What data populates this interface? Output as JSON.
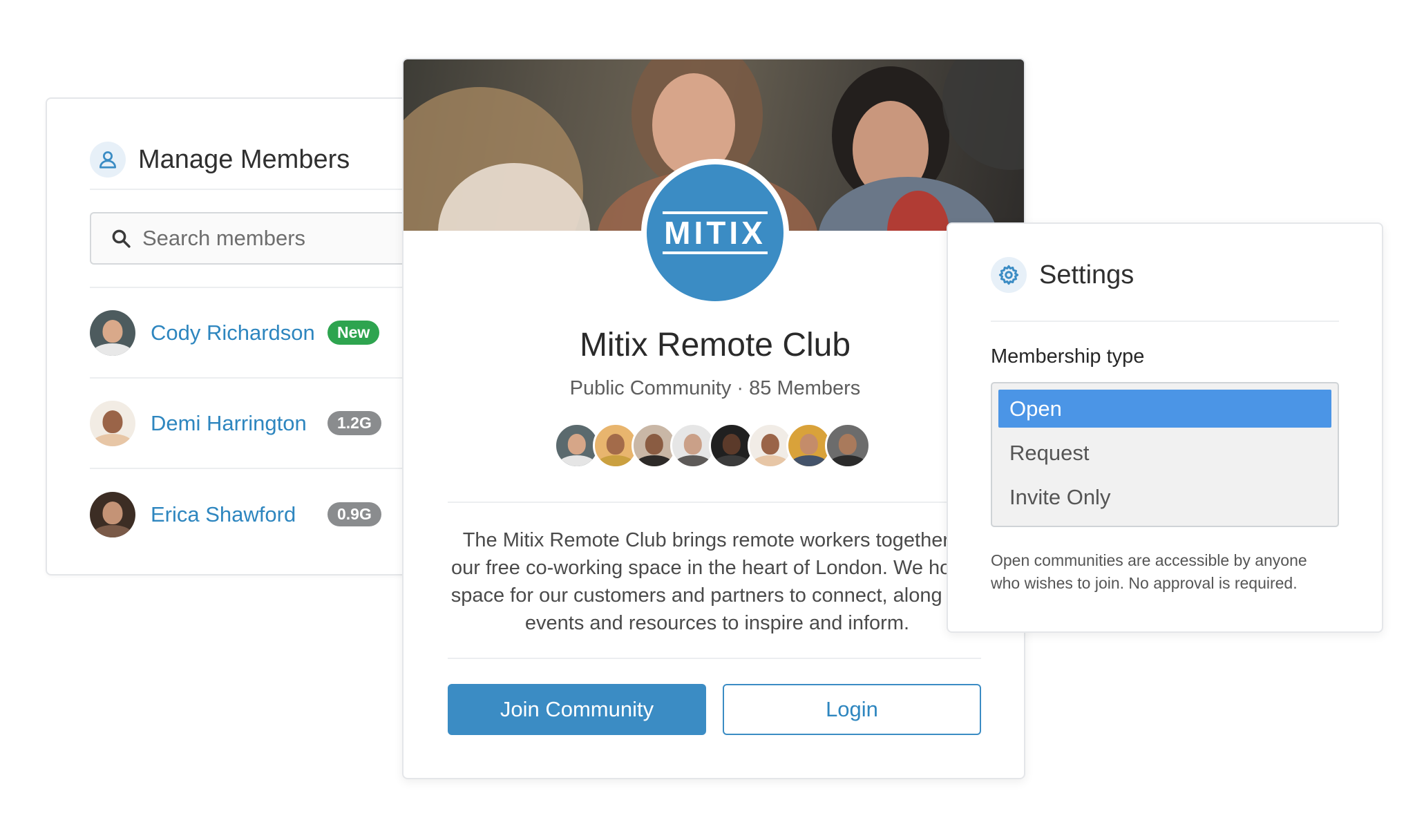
{
  "members_panel": {
    "title": "Manage Members",
    "icon": "user-icon",
    "search_placeholder": "Search members",
    "members": [
      {
        "name": "Cody Richardson",
        "badge": "New",
        "badge_color": "#2ea44f"
      },
      {
        "name": "Demi Harrington",
        "badge": "1.2G",
        "badge_color": "#8a8c8e"
      },
      {
        "name": "Erica Shawford",
        "badge": "0.9G",
        "badge_color": "#8a8c8e"
      }
    ]
  },
  "community": {
    "logo_text": "MITIX",
    "name": "Mitix Remote Club",
    "meta": "Public Community · 85 Members",
    "member_avatar_count": 8,
    "description": "The Mitix Remote Club brings remote workers together at our free co-working space in the heart of London. We host a space for our customers and partners to connect, along with events and resources to inspire and inform.",
    "join_label": "Join Community",
    "login_label": "Login",
    "accent_color": "#3b8cc4"
  },
  "settings_panel": {
    "title": "Settings",
    "icon": "gear-icon",
    "field_label": "Membership type",
    "options": [
      "Open",
      "Request",
      "Invite Only"
    ],
    "selected_option": "Open",
    "help_text": "Open communities are accessible by anyone who wishes to join. No approval is required."
  }
}
